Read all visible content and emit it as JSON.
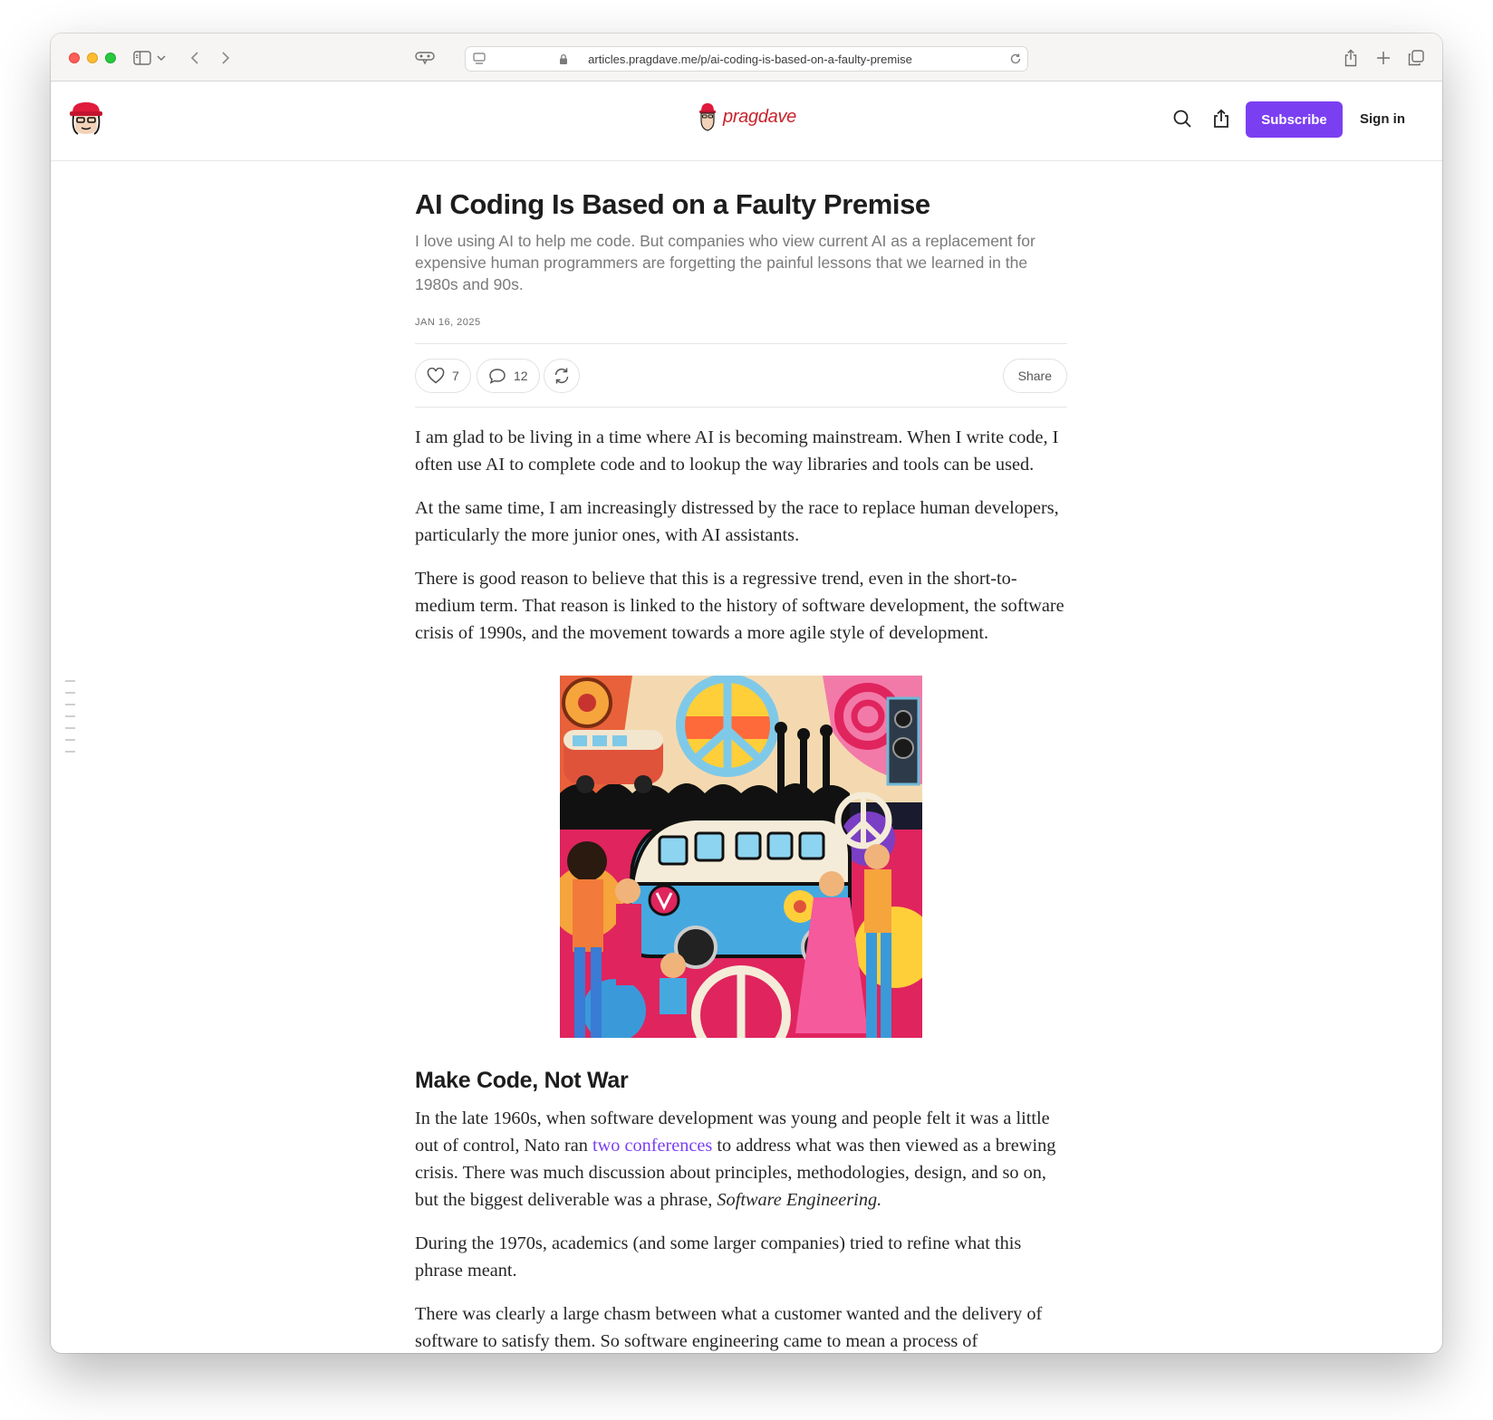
{
  "browser": {
    "url": "articles.pragdave.me/p/ai-coding-is-based-on-a-faulty-premise"
  },
  "site": {
    "brand": "pragdave",
    "subscribe_label": "Subscribe",
    "signin_label": "Sign in",
    "brand_color": "#c8232c",
    "accent_color": "#7b3ff2"
  },
  "article": {
    "title": "AI Coding Is Based on a Faulty Premise",
    "subtitle": "I love using AI to help me code. But companies who view current AI as a replacement for expensive human programmers are forgetting the painful lessons that we learned in the 1980s and 90s.",
    "date": "JAN 16, 2025",
    "likes": "7",
    "comments": "12",
    "share_label": "Share",
    "paragraphs": [
      "I am glad to be living in a time where AI is becoming mainstream. When I write code, I often use AI to complete code and to lookup the way libraries and tools can be used.",
      "At the same time, I am increasingly distressed by the race to replace human developers, particularly the more junior ones, with AI assistants.",
      "There is good reason to believe that this is a regressive trend, even in the short-to-medium term. That reason is linked to the history of software development, the software crisis of 1990s, and the movement towards a more agile style of development."
    ],
    "section_heading": "Make Code, Not War",
    "section_p1_before": "In the late 1960s, when software development was young and people felt it was a little out of control, Nato ran ",
    "section_p1_link": "two conferences",
    "section_p1_after": " to address what was then viewed as a brewing crisis. There was much discussion about principles, methodologies, design, and so on, but the biggest deliverable was a phrase, ",
    "section_p1_italic": "Software Engineering.",
    "section_p2": "During the 1970s, academics (and some larger companies) tried to refine what this phrase meant.",
    "section_p3": "There was clearly a large chasm between what a customer wanted and the delivery of software to satisfy them. So software engineering came to mean a process of"
  }
}
